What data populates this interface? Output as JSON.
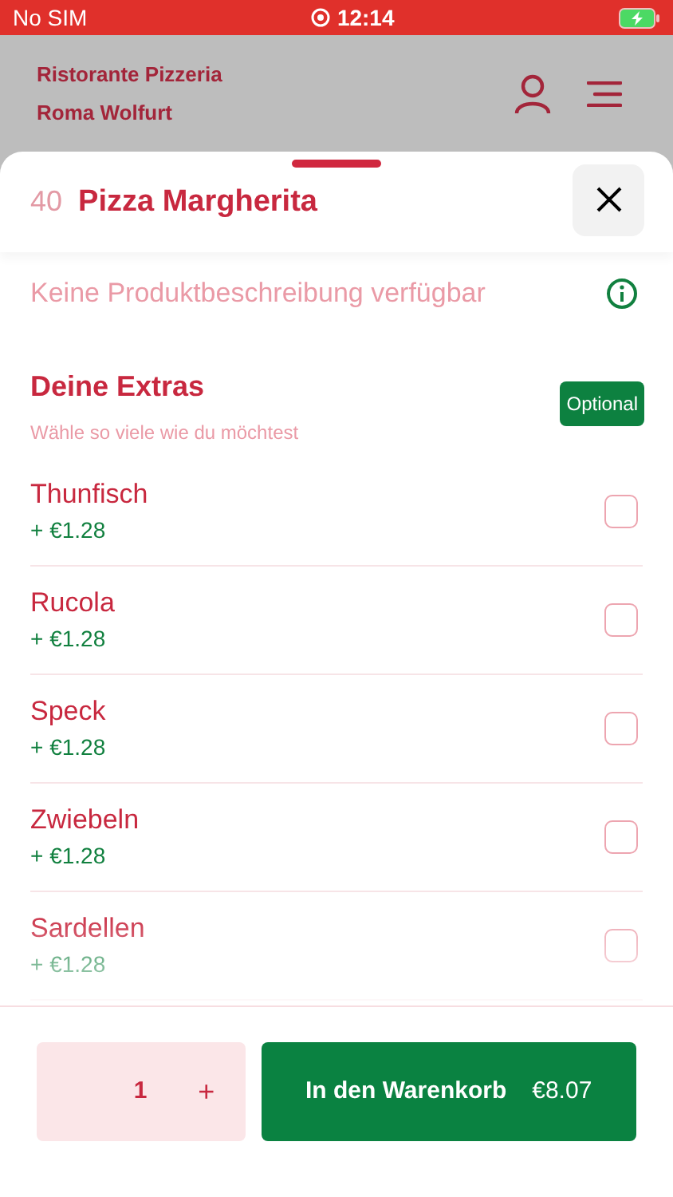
{
  "status_bar": {
    "carrier": "No SIM",
    "time": "12:14"
  },
  "header": {
    "restaurant_line_1": "Ristorante Pizzeria",
    "restaurant_line_2": "Roma Wolfurt"
  },
  "product": {
    "number": "40",
    "name": "Pizza Margherita",
    "description": "Keine Produktbeschreibung verfügbar"
  },
  "extras": {
    "title": "Deine Extras",
    "subtitle": "Wähle so viele wie du möchtest",
    "badge": "Optional",
    "items": [
      {
        "name": "Thunfisch",
        "price": "+ €1.28",
        "checked": false
      },
      {
        "name": "Rucola",
        "price": "+ €1.28",
        "checked": false
      },
      {
        "name": "Speck",
        "price": "+ €1.28",
        "checked": false
      },
      {
        "name": "Zwiebeln",
        "price": "+ €1.28",
        "checked": false
      },
      {
        "name": "Sardellen",
        "price": "+ €1.28",
        "checked": false
      }
    ]
  },
  "footer": {
    "quantity": "1",
    "plus": "+",
    "add_button": "In den Warenkorb",
    "total": "€8.07"
  }
}
